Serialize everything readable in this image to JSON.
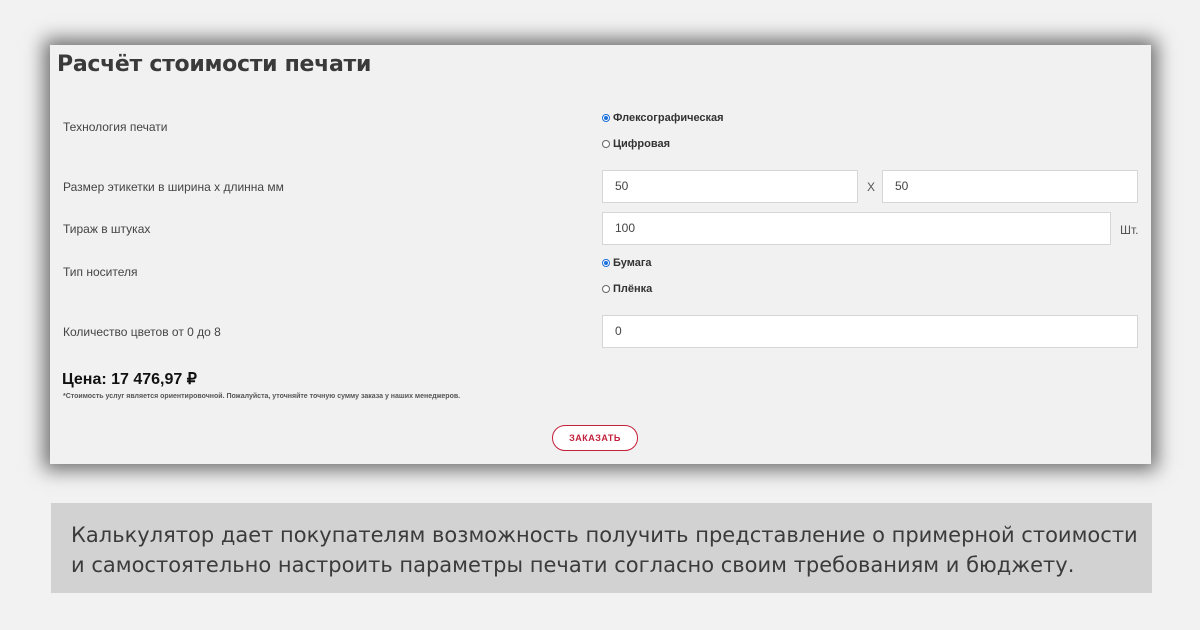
{
  "calculator": {
    "title": "Расчёт стоимости печати",
    "technology": {
      "label": "Технология печати",
      "options": [
        {
          "label": "Флексографическая",
          "selected": true
        },
        {
          "label": "Цифровая",
          "selected": false
        }
      ]
    },
    "size": {
      "label": "Размер этикетки в ширина х длинна мм",
      "width_value": "50",
      "separator": "Х",
      "length_value": "50"
    },
    "quantity": {
      "label": "Тираж в штуках",
      "value": "100",
      "unit": "Шт."
    },
    "material": {
      "label": "Тип носителя",
      "options": [
        {
          "label": "Бумага",
          "selected": true
        },
        {
          "label": "Плёнка",
          "selected": false
        }
      ]
    },
    "colors": {
      "label": "Количество цветов от 0 до 8",
      "value": "0"
    },
    "price": "Цена: 17 476,97 ₽",
    "note": "*Стоимость услуг является ориентировочной. Пожалуйста, уточняйте точную сумму заказа у наших менеджеров.",
    "order_button": "ЗАКАЗАТЬ"
  },
  "caption": "Калькулятор дает покупателям возможность получить представление о примерной стоимости и самостоятельно настроить параметры печати согласно своим требованиям и бюджету.",
  "colors": {
    "accent": "#c3203a",
    "radio_selected": "#1e70d8",
    "caption_bg": "#d2d2d2"
  }
}
